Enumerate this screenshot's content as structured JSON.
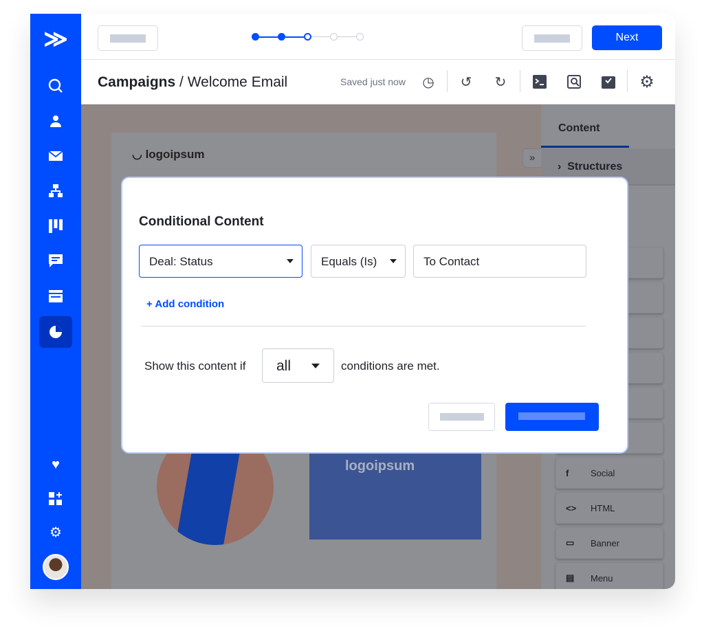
{
  "sidebar": {
    "items": [
      "logo",
      "search",
      "contacts",
      "email",
      "automations",
      "pipelines",
      "conversations",
      "site",
      "reports",
      "favorites",
      "apps",
      "settings",
      "profile"
    ],
    "active": "reports"
  },
  "topbar": {
    "next_label": "Next",
    "steps": {
      "total": 5,
      "completed": 2,
      "current": 3
    }
  },
  "breadcrumb": {
    "parent": "Campaigns",
    "separator": " / ",
    "current": "Welcome Email",
    "saved_status": "Saved just now"
  },
  "toolbar": {
    "icons": [
      "history-icon",
      "undo-icon",
      "redo-icon",
      "code-icon",
      "preview-icon",
      "test-icon",
      "gear-icon"
    ]
  },
  "email": {
    "logo_text": "logoipsum",
    "banner_logo": "logoipsum"
  },
  "panel": {
    "tab": "Content",
    "section": "Structures",
    "collapse": "»",
    "tiles": [
      {
        "label": "",
        "icon": ""
      },
      {
        "label": "",
        "icon": ""
      },
      {
        "label": "",
        "icon": ""
      },
      {
        "label": "",
        "icon": ""
      },
      {
        "label": "",
        "icon": ""
      },
      {
        "label": "",
        "icon": ""
      },
      {
        "label": "Social",
        "icon": "f"
      },
      {
        "label": "HTML",
        "icon": "<>"
      },
      {
        "label": "Banner",
        "icon": "▭"
      },
      {
        "label": "Menu",
        "icon": "▤"
      }
    ]
  },
  "modal": {
    "title": "Conditional Content",
    "field": "Deal: Status",
    "operator": "Equals (Is)",
    "value": "To Contact",
    "add_condition": "+ Add condition",
    "show_prefix": "Show this content if",
    "match": "all",
    "show_suffix": "conditions are met."
  },
  "colors": {
    "brand": "#004cff",
    "sidebar_active": "#0033c0"
  }
}
